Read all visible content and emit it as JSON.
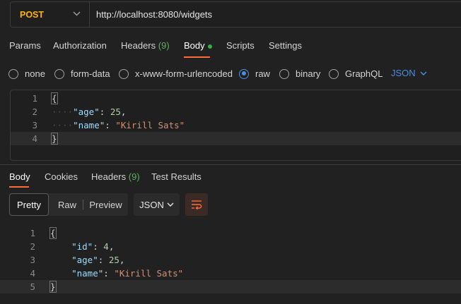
{
  "request": {
    "method": "POST",
    "url": "http://localhost:8080/widgets"
  },
  "request_tabs": [
    {
      "label": "Params"
    },
    {
      "label": "Authorization"
    },
    {
      "label": "Headers",
      "count": "(9)"
    },
    {
      "label": "Body",
      "active": true
    },
    {
      "label": "Scripts"
    },
    {
      "label": "Settings"
    }
  ],
  "body_types": [
    {
      "label": "none"
    },
    {
      "label": "form-data"
    },
    {
      "label": "x-www-form-urlencoded"
    },
    {
      "label": "raw",
      "checked": true
    },
    {
      "label": "binary"
    },
    {
      "label": "GraphQL"
    }
  ],
  "body_format": "JSON",
  "request_body_lines": [
    {
      "n": "1",
      "text": "{"
    },
    {
      "n": "2",
      "key": "\"age\"",
      "value": "25",
      "value_type": "num",
      "comma": true
    },
    {
      "n": "3",
      "key": "\"name\"",
      "value": "\"Kirill Sats\"",
      "value_type": "str",
      "comma": false
    },
    {
      "n": "4",
      "text": "}"
    }
  ],
  "response_tabs": [
    {
      "label": "Body",
      "active": true
    },
    {
      "label": "Cookies"
    },
    {
      "label": "Headers",
      "count": "(9)"
    },
    {
      "label": "Test Results"
    }
  ],
  "view_modes": [
    {
      "label": "Pretty",
      "active": true
    },
    {
      "label": "Raw"
    },
    {
      "label": "Preview"
    }
  ],
  "response_format": "JSON",
  "response_body_lines": [
    {
      "n": "1",
      "text": "{"
    },
    {
      "n": "2",
      "key": "\"id\"",
      "value": "4",
      "value_type": "num",
      "comma": true
    },
    {
      "n": "3",
      "key": "\"age\"",
      "value": "25",
      "value_type": "num",
      "comma": true
    },
    {
      "n": "4",
      "key": "\"name\"",
      "value": "\"Kirill Sats\"",
      "value_type": "str",
      "comma": false
    },
    {
      "n": "5",
      "text": "}"
    }
  ],
  "colors": {
    "method": "#ffb400",
    "accent": "#ff6c37",
    "link": "#4a8ee6",
    "count": "#5ab45a",
    "body_dot": "#2fb344"
  }
}
